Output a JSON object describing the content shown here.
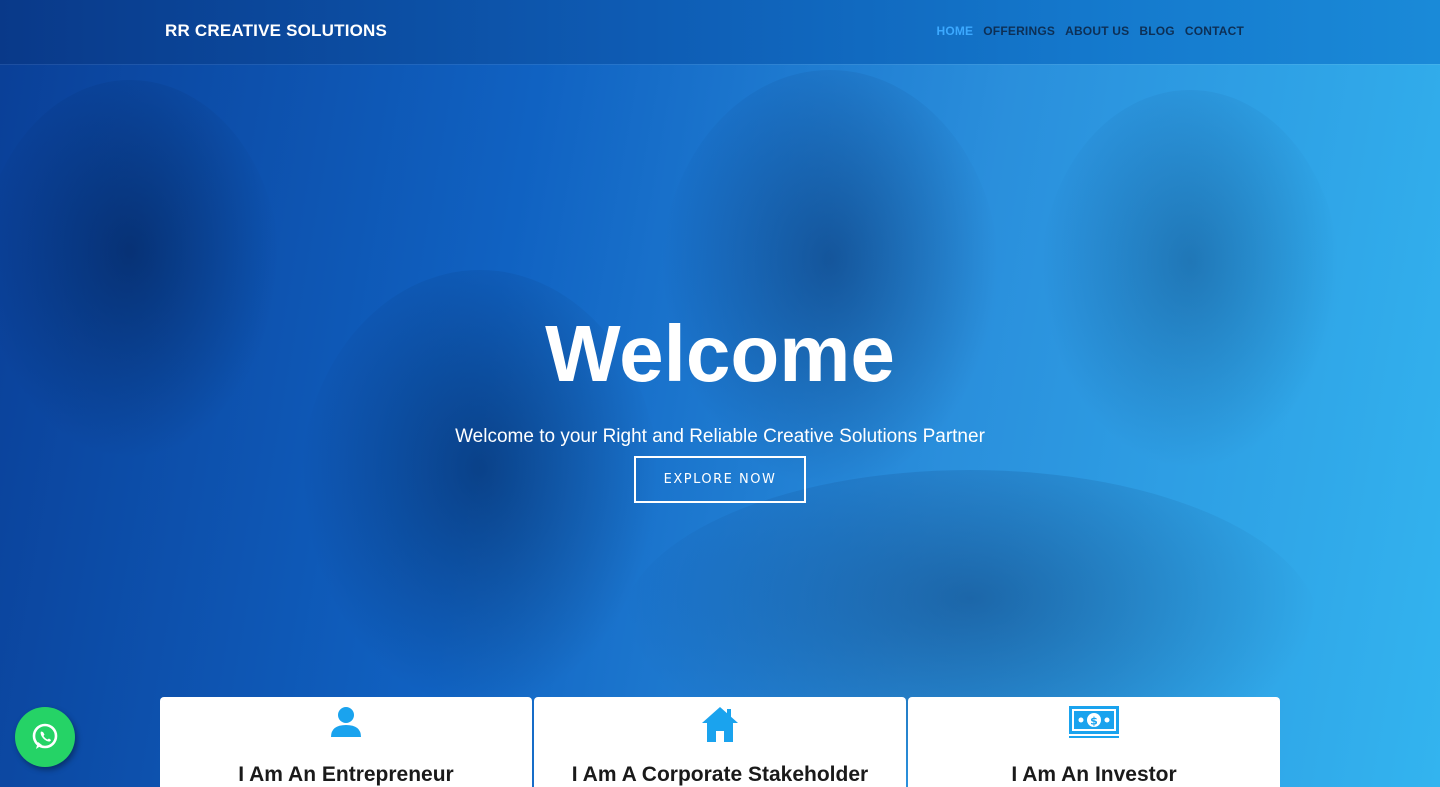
{
  "brand": "RR CREATIVE SOLUTIONS",
  "nav": [
    {
      "label": "HOME",
      "active": true
    },
    {
      "label": "OFFERINGS",
      "active": false
    },
    {
      "label": "ABOUT US",
      "active": false
    },
    {
      "label": "BLOG",
      "active": false
    },
    {
      "label": "CONTACT",
      "active": false
    }
  ],
  "hero": {
    "title": "Welcome",
    "subtitle": "Welcome to your Right and Reliable Creative Solutions Partner",
    "cta": "EXPLORE NOW"
  },
  "cards": [
    {
      "label": "I Am An Entrepreneur",
      "icon": "user-icon"
    },
    {
      "label": "I Am A Corporate Stakeholder",
      "icon": "home-icon"
    },
    {
      "label": "I Am An Investor",
      "icon": "money-icon"
    }
  ],
  "colors": {
    "accent": "#1aa3ee",
    "nav_active": "#3ca9ff",
    "whatsapp": "#25d366"
  },
  "whatsapp_icon": "whatsapp-icon"
}
